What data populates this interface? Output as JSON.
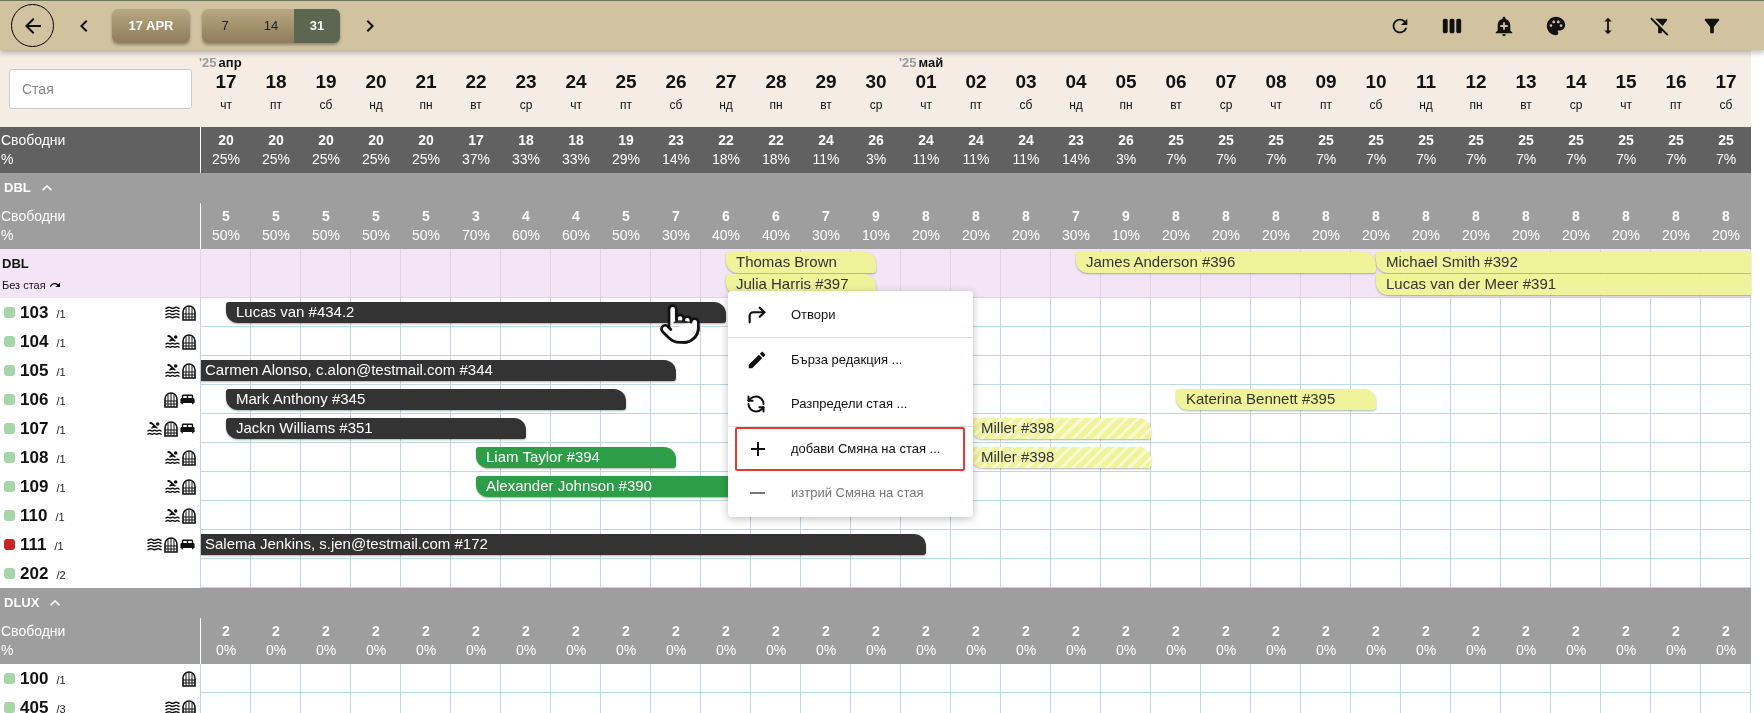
{
  "toolbar": {
    "date_button": "17 APR",
    "ranges": [
      {
        "label": "7",
        "selected": false
      },
      {
        "label": "14",
        "selected": false
      },
      {
        "label": "31",
        "selected": true
      }
    ],
    "actions": [
      {
        "kind": "refresh"
      },
      {
        "kind": "columns"
      },
      {
        "kind": "alert"
      },
      {
        "kind": "palette"
      },
      {
        "kind": "height"
      },
      {
        "kind": "filter_off"
      },
      {
        "kind": "filter"
      }
    ]
  },
  "search": {
    "placeholder": "Стая"
  },
  "days": [
    {
      "num": "17",
      "dow": "чт",
      "month": {
        "year": "'25",
        "name": "апр"
      }
    },
    {
      "num": "18",
      "dow": "пт"
    },
    {
      "num": "19",
      "dow": "сб"
    },
    {
      "num": "20",
      "dow": "нд"
    },
    {
      "num": "21",
      "dow": "пн"
    },
    {
      "num": "22",
      "dow": "вт"
    },
    {
      "num": "23",
      "dow": "ср"
    },
    {
      "num": "24",
      "dow": "чт"
    },
    {
      "num": "25",
      "dow": "пт"
    },
    {
      "num": "26",
      "dow": "сб"
    },
    {
      "num": "27",
      "dow": "нд"
    },
    {
      "num": "28",
      "dow": "пн"
    },
    {
      "num": "29",
      "dow": "вт"
    },
    {
      "num": "30",
      "dow": "ср"
    },
    {
      "num": "01",
      "dow": "чт",
      "month": {
        "year": "'25",
        "name": "май"
      }
    },
    {
      "num": "02",
      "dow": "пт"
    },
    {
      "num": "03",
      "dow": "сб"
    },
    {
      "num": "04",
      "dow": "нд"
    },
    {
      "num": "05",
      "dow": "пн"
    },
    {
      "num": "06",
      "dow": "вт"
    },
    {
      "num": "07",
      "dow": "ср"
    },
    {
      "num": "08",
      "dow": "чт"
    },
    {
      "num": "09",
      "dow": "пт"
    },
    {
      "num": "10",
      "dow": "сб"
    },
    {
      "num": "11",
      "dow": "нд"
    },
    {
      "num": "12",
      "dow": "пн"
    },
    {
      "num": "13",
      "dow": "вт"
    },
    {
      "num": "14",
      "dow": "ср"
    },
    {
      "num": "15",
      "dow": "чт"
    },
    {
      "num": "16",
      "dow": "пт"
    },
    {
      "num": "17",
      "dow": "сб"
    }
  ],
  "totals": {
    "label": "Свободни",
    "pct_label": "%",
    "values": [
      {
        "count": "20",
        "pct": "25%"
      },
      {
        "count": "20",
        "pct": "25%"
      },
      {
        "count": "20",
        "pct": "25%"
      },
      {
        "count": "20",
        "pct": "25%"
      },
      {
        "count": "20",
        "pct": "25%"
      },
      {
        "count": "17",
        "pct": "37%"
      },
      {
        "count": "18",
        "pct": "33%"
      },
      {
        "count": "18",
        "pct": "33%"
      },
      {
        "count": "19",
        "pct": "29%"
      },
      {
        "count": "23",
        "pct": "14%"
      },
      {
        "count": "22",
        "pct": "18%"
      },
      {
        "count": "22",
        "pct": "18%"
      },
      {
        "count": "24",
        "pct": "11%"
      },
      {
        "count": "26",
        "pct": "3%"
      },
      {
        "count": "24",
        "pct": "11%"
      },
      {
        "count": "24",
        "pct": "11%"
      },
      {
        "count": "24",
        "pct": "11%"
      },
      {
        "count": "23",
        "pct": "14%"
      },
      {
        "count": "26",
        "pct": "3%"
      },
      {
        "count": "25",
        "pct": "7%"
      },
      {
        "count": "25",
        "pct": "7%"
      },
      {
        "count": "25",
        "pct": "7%"
      },
      {
        "count": "25",
        "pct": "7%"
      },
      {
        "count": "25",
        "pct": "7%"
      },
      {
        "count": "25",
        "pct": "7%"
      },
      {
        "count": "25",
        "pct": "7%"
      },
      {
        "count": "25",
        "pct": "7%"
      },
      {
        "count": "25",
        "pct": "7%"
      },
      {
        "count": "25",
        "pct": "7%"
      },
      {
        "count": "25",
        "pct": "7%"
      },
      {
        "count": "25",
        "pct": "7%"
      }
    ]
  },
  "groups": [
    {
      "name": "DBL",
      "expanded": true,
      "free": {
        "label": "Свободни",
        "pct_label": "%",
        "values": [
          {
            "count": "5",
            "pct": "50%"
          },
          {
            "count": "5",
            "pct": "50%"
          },
          {
            "count": "5",
            "pct": "50%"
          },
          {
            "count": "5",
            "pct": "50%"
          },
          {
            "count": "5",
            "pct": "50%"
          },
          {
            "count": "3",
            "pct": "70%"
          },
          {
            "count": "4",
            "pct": "60%"
          },
          {
            "count": "4",
            "pct": "60%"
          },
          {
            "count": "5",
            "pct": "50%"
          },
          {
            "count": "7",
            "pct": "30%"
          },
          {
            "count": "6",
            "pct": "40%"
          },
          {
            "count": "6",
            "pct": "40%"
          },
          {
            "count": "7",
            "pct": "30%"
          },
          {
            "count": "9",
            "pct": "10%"
          },
          {
            "count": "8",
            "pct": "20%"
          },
          {
            "count": "8",
            "pct": "20%"
          },
          {
            "count": "8",
            "pct": "20%"
          },
          {
            "count": "7",
            "pct": "30%"
          },
          {
            "count": "9",
            "pct": "10%"
          },
          {
            "count": "8",
            "pct": "20%"
          },
          {
            "count": "8",
            "pct": "20%"
          },
          {
            "count": "8",
            "pct": "20%"
          },
          {
            "count": "8",
            "pct": "20%"
          },
          {
            "count": "8",
            "pct": "20%"
          },
          {
            "count": "8",
            "pct": "20%"
          },
          {
            "count": "8",
            "pct": "20%"
          },
          {
            "count": "8",
            "pct": "20%"
          },
          {
            "count": "8",
            "pct": "20%"
          },
          {
            "count": "8",
            "pct": "20%"
          },
          {
            "count": "8",
            "pct": "20%"
          },
          {
            "count": "8",
            "pct": "20%"
          }
        ]
      },
      "unassigned": {
        "title": "DBL",
        "subtitle": "Без стая",
        "bookings": [
          {
            "text": "Thomas Brown",
            "color": "#eff39a",
            "kind": "solid"
          },
          {
            "text": "Julia Harris #397",
            "color": "#eff39a",
            "kind": "solid"
          },
          {
            "text": "James Anderson #396",
            "color": "#eff39a",
            "kind": "solid"
          },
          {
            "text": "Michael Smith #392",
            "color": "#eff39a",
            "kind": "solid"
          },
          {
            "text": "Lucas van der Meer #391",
            "color": "#eff39a",
            "kind": "solid"
          }
        ]
      },
      "rooms": [
        {
          "number": "103",
          "beds": "/1",
          "color": "#a5d6a7",
          "features": [
            {
              "kind": "sea"
            },
            {
              "kind": "window"
            }
          ],
          "bookings": [
            {
              "text": "Lucas van #434.2",
              "color": "#333333",
              "kind": "solid"
            }
          ]
        },
        {
          "number": "104",
          "beds": "/1",
          "color": "#a5d6a7",
          "features": [
            {
              "kind": "pool"
            },
            {
              "kind": "window"
            }
          ]
        },
        {
          "number": "105",
          "beds": "/1",
          "color": "#a5d6a7",
          "features": [
            {
              "kind": "pool"
            },
            {
              "kind": "window"
            }
          ],
          "bookings": [
            {
              "text": "Carmen Alonso, c.alon@testmail.com #344",
              "color": "#333333",
              "kind": "solid"
            }
          ]
        },
        {
          "number": "106",
          "beds": "/1",
          "color": "#a5d6a7",
          "features": [
            {
              "kind": "window"
            },
            {
              "kind": "bed"
            }
          ],
          "bookings": [
            {
              "text": "Mark Anthony #345",
              "color": "#333333",
              "kind": "solid"
            },
            {
              "text": "Katerina Bennett #395",
              "color": "#eff39a",
              "kind": "solid"
            }
          ]
        },
        {
          "number": "107",
          "beds": "/1",
          "color": "#a5d6a7",
          "features": [
            {
              "kind": "pool"
            },
            {
              "kind": "window"
            },
            {
              "kind": "bed"
            }
          ],
          "bookings": [
            {
              "text": "Jackn Williams #351",
              "color": "#333333",
              "kind": "solid"
            },
            {
              "text": "Miller #398",
              "color": "#eff39a",
              "kind": "striped"
            }
          ]
        },
        {
          "number": "108",
          "beds": "/1",
          "color": "#a5d6a7",
          "features": [
            {
              "kind": "pool"
            },
            {
              "kind": "window"
            }
          ],
          "bookings": [
            {
              "text": "Liam Taylor #394",
              "color": "#2e9d48",
              "kind": "solid"
            },
            {
              "text": "Miller #398",
              "color": "#eff39a",
              "kind": "striped"
            }
          ]
        },
        {
          "number": "109",
          "beds": "/1",
          "color": "#a5d6a7",
          "features": [
            {
              "kind": "pool"
            },
            {
              "kind": "window"
            }
          ],
          "bookings": [
            {
              "text": "Alexander Johnson #390",
              "color": "#2e9d48",
              "kind": "solid"
            }
          ]
        },
        {
          "number": "110",
          "beds": "/1",
          "color": "#a5d6a7",
          "features": [
            {
              "kind": "pool"
            },
            {
              "kind": "window"
            }
          ]
        },
        {
          "number": "111",
          "beds": "/1",
          "color": "#c62828",
          "features": [
            {
              "kind": "sea"
            },
            {
              "kind": "window"
            },
            {
              "kind": "bed"
            }
          ],
          "bookings": [
            {
              "text": "Salema Jenkins, s.jen@testmail.com #172",
              "color": "#333333",
              "kind": "solid"
            }
          ]
        },
        {
          "number": "202",
          "beds": "/2",
          "color": "#a5d6a7"
        }
      ]
    },
    {
      "name": "DLUX",
      "expanded": true,
      "free": {
        "label": "Свободни",
        "pct_label": "%",
        "values": [
          {
            "count": "2",
            "pct": "0%"
          },
          {
            "count": "2",
            "pct": "0%"
          },
          {
            "count": "2",
            "pct": "0%"
          },
          {
            "count": "2",
            "pct": "0%"
          },
          {
            "count": "2",
            "pct": "0%"
          },
          {
            "count": "2",
            "pct": "0%"
          },
          {
            "count": "2",
            "pct": "0%"
          },
          {
            "count": "2",
            "pct": "0%"
          },
          {
            "count": "2",
            "pct": "0%"
          },
          {
            "count": "2",
            "pct": "0%"
          },
          {
            "count": "2",
            "pct": "0%"
          },
          {
            "count": "2",
            "pct": "0%"
          },
          {
            "count": "2",
            "pct": "0%"
          },
          {
            "count": "2",
            "pct": "0%"
          },
          {
            "count": "2",
            "pct": "0%"
          },
          {
            "count": "2",
            "pct": "0%"
          },
          {
            "count": "2",
            "pct": "0%"
          },
          {
            "count": "2",
            "pct": "0%"
          },
          {
            "count": "2",
            "pct": "0%"
          },
          {
            "count": "2",
            "pct": "0%"
          },
          {
            "count": "2",
            "pct": "0%"
          },
          {
            "count": "2",
            "pct": "0%"
          },
          {
            "count": "2",
            "pct": "0%"
          },
          {
            "count": "2",
            "pct": "0%"
          },
          {
            "count": "2",
            "pct": "0%"
          },
          {
            "count": "2",
            "pct": "0%"
          },
          {
            "count": "2",
            "pct": "0%"
          },
          {
            "count": "2",
            "pct": "0%"
          },
          {
            "count": "2",
            "pct": "0%"
          },
          {
            "count": "2",
            "pct": "0%"
          },
          {
            "count": "2",
            "pct": "0%"
          }
        ]
      },
      "rooms": [
        {
          "number": "100",
          "beds": "/1",
          "color": "#a5d6a7",
          "features": [
            {
              "kind": "window"
            }
          ]
        },
        {
          "number": "405",
          "beds": "/3",
          "color": "#a5d6a7",
          "features": [
            {
              "kind": "sea"
            },
            {
              "kind": "window"
            }
          ]
        }
      ]
    }
  ],
  "context_menu": {
    "items": [
      {
        "kind": "open",
        "label": "Отвори",
        "selected": false,
        "disabled": false
      },
      {
        "kind": "edit",
        "label": "Бърза редакция ...",
        "selected": false,
        "disabled": false
      },
      {
        "kind": "assign",
        "label": "Разпредели стая ...",
        "selected": false,
        "disabled": false
      },
      {
        "kind": "add",
        "label": "добави Смяна на стая ...",
        "selected": true,
        "disabled": false
      },
      {
        "kind": "remove",
        "label": "изтрий Смяна на стая",
        "selected": false,
        "disabled": true
      }
    ]
  }
}
